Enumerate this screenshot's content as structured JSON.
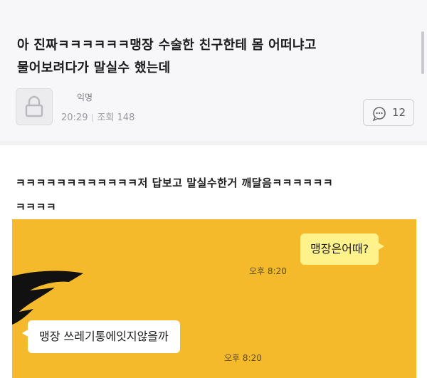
{
  "post": {
    "title_line1": "아 진짜ㅋㅋㅋㅋㅋㅋ맹장 수술한 친구한테 몸 어떠냐고",
    "title_line2": "물어보려다가 말실수 했는데",
    "author": "익명",
    "time": "20:29",
    "views": "조회 148",
    "comment_count": "12",
    "body_line1": "ㅋㅋㅋㅋㅋㅋㅋㅋㅋㅋㅋㅋ저 답보고 말실수한거 깨달음ㅋㅋㅋㅋㅋㅋ",
    "body_line2": "ㅋㅋㅋㅋ"
  },
  "chat": {
    "my_message": "맹장은어때?",
    "my_time": "오후 8:20",
    "friend_message": "맹장 쓰레기통에잇지않을까",
    "friend_time": "오후 8:20"
  },
  "colors": {
    "chat_bg": "#f4ba2b",
    "my_bubble": "#fff28a",
    "friend_bubble": "#ffffff"
  },
  "icons": [
    "lock-icon",
    "comment-bubble-icon"
  ]
}
